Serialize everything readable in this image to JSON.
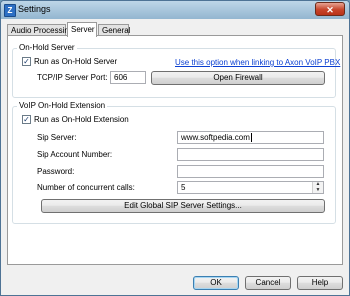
{
  "window": {
    "title": "Settings",
    "close_glyph": "✕"
  },
  "tabs": [
    {
      "label": "Audio Processing"
    },
    {
      "label": "Server"
    },
    {
      "label": "General"
    }
  ],
  "onhold_server": {
    "group_label": "On-Hold Server",
    "run_checkbox_label": "Run as On-Hold Server",
    "run_checked": true,
    "link_text": "Use this option when linking to Axon VoIP PBX",
    "port_label": "TCP/IP Server Port:",
    "port_value": "606",
    "open_firewall_label": "Open Firewall"
  },
  "voip_extension": {
    "group_label": "VoIP On-Hold Extension",
    "run_checkbox_label": "Run as On-Hold Extension",
    "run_checked": true,
    "sip_server_label": "Sip Server:",
    "sip_server_value": "www.softpedia.com",
    "sip_account_label": "Sip Account Number:",
    "sip_account_value": "",
    "password_label": "Password:",
    "password_value": "",
    "concurrent_label": "Number of concurrent calls:",
    "concurrent_value": "5",
    "edit_global_label": "Edit Global SIP Server Settings..."
  },
  "footer": {
    "ok_label": "OK",
    "cancel_label": "Cancel",
    "help_label": "Help"
  },
  "icons": {
    "check": "✓",
    "spin_up": "▲",
    "spin_down": "▼",
    "app": "Z"
  }
}
